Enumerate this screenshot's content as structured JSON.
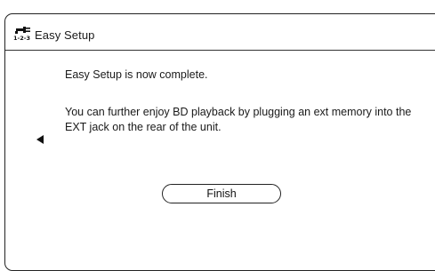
{
  "header": {
    "title": "Easy Setup",
    "icon": "setup-tools-icon",
    "icon_caption": "1-2-3"
  },
  "messages": {
    "complete": "Easy Setup is now complete.",
    "info": "You can further enjoy BD playback by plugging an ext memory into the EXT jack on the rear of the unit."
  },
  "navigation": {
    "back_icon": "left-arrow-icon"
  },
  "actions": {
    "finish_label": "Finish"
  }
}
